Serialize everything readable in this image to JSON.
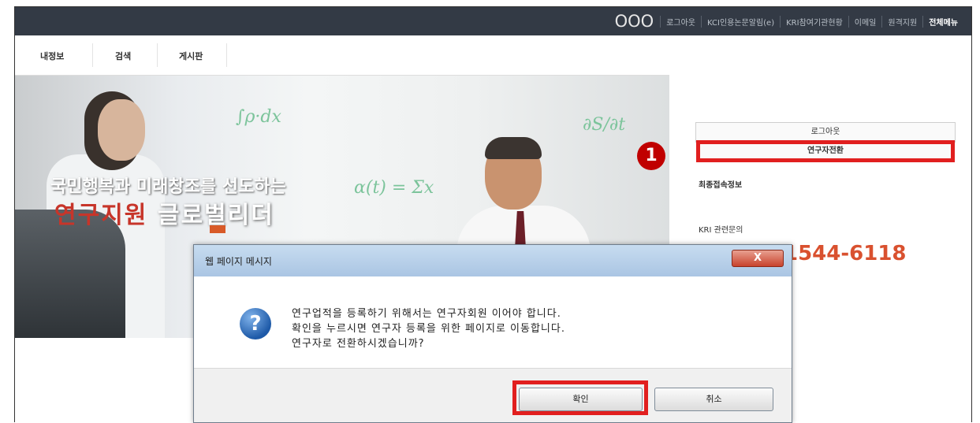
{
  "topbar": {
    "logo": "OOO",
    "links": [
      "로그아웃",
      "KCI인용논문알림(e)",
      "KRI참여기관현황",
      "이메일",
      "원격지원",
      "전체메뉴"
    ]
  },
  "menu": {
    "items": [
      "내정보",
      "검색",
      "게시판"
    ]
  },
  "banner": {
    "slogan_line1": "국민행복과 미래창조를 선도하는",
    "slogan_line2_a": "연구지원",
    "slogan_line2_b": "글로벌리더"
  },
  "sidebar": {
    "logout_label": "로그아웃",
    "switch_label": "연구자전환",
    "badge": "1",
    "last_login_label": "최종접속정보",
    "contact_label": "KRI 관련문의",
    "phone": "1544-6118"
  },
  "dialog": {
    "title": "웹 페이지 메시지",
    "close": "X",
    "message_lines": [
      "연구업적을 등록하기 위해서는 연구자회원 이어야 합니다.",
      "확인을 누르시면 연구자 등록을 위한 페이지로 이동합니다.",
      "연구자로 전환하시겠습니까?"
    ],
    "ok_label": "확인",
    "cancel_label": "취소"
  },
  "colors": {
    "highlight": "#e11f1f",
    "badge": "#c00000",
    "topbar": "#333a45",
    "phone": "#d9512f"
  }
}
